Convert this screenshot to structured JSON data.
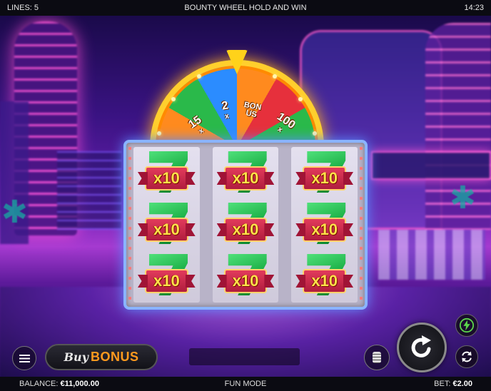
{
  "top_bar": {
    "lines": "LINES: 5",
    "title": "BOUNTY WHEEL HOLD AND WIN",
    "clock": "14:23"
  },
  "wheel": {
    "segments": [
      {
        "value": "15",
        "suffix": "x"
      },
      {
        "value": "2",
        "suffix": "x"
      },
      {
        "value": "BONUS",
        "suffix": ""
      },
      {
        "value": "100",
        "suffix": "x"
      }
    ]
  },
  "reels": [
    [
      "x10",
      "x10",
      "x10"
    ],
    [
      "x10",
      "x10",
      "x10"
    ],
    [
      "x10",
      "x10",
      "x10"
    ]
  ],
  "controls": {
    "buy_bonus_prefix": "Buy",
    "buy_bonus_label": "BONUS"
  },
  "bottom_bar": {
    "balance_label": "BALANCE:",
    "balance_value": "€11,000.00",
    "mode": "FUN MODE",
    "bet_label": "BET:",
    "bet_value": "€2.00"
  },
  "icons": {
    "menu": "hamburger-icon",
    "coins": "coin-stack-icon",
    "spin": "spin-arrow-icon",
    "turbo": "lightning-icon",
    "autoplay": "autoplay-arrows-icon"
  },
  "colors": {
    "bonus_orange": "#ff9a1e",
    "multiplier_yellow": "#ffe14a",
    "turbo_green": "#5bd54a",
    "reel_frame": "#8ab4ff"
  }
}
